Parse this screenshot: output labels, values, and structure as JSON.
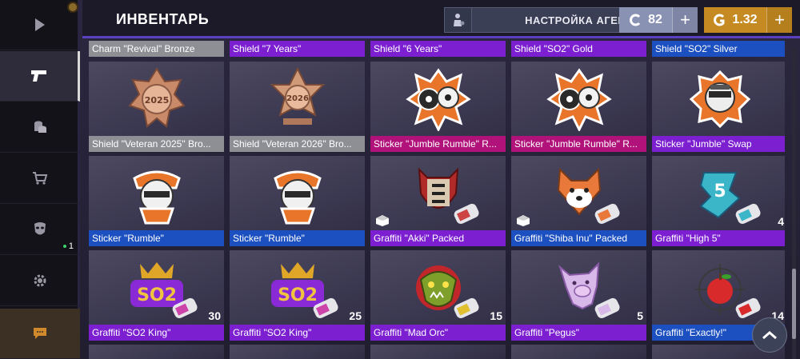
{
  "header": {
    "title": "ИНВЕНТАРЬ",
    "agent_button": "НАСТРОЙКА АГЕНТА",
    "silver_amount": "82",
    "gold_amount": "1.32",
    "plus": "+"
  },
  "sidebar": {
    "items": [
      {
        "name": "play",
        "icon": "play-icon"
      },
      {
        "name": "inventory",
        "icon": "pistol-icon"
      },
      {
        "name": "coins",
        "icon": "coins-icon"
      },
      {
        "name": "shop",
        "icon": "cart-icon"
      },
      {
        "name": "clan",
        "icon": "mask-icon",
        "badge": "1"
      },
      {
        "name": "settings",
        "icon": "gear-icon"
      },
      {
        "name": "chat",
        "icon": "chat-icon"
      }
    ]
  },
  "top_strip": [
    {
      "name": "Charm \"Revival\" Bronze",
      "rarity": "bronze"
    },
    {
      "name": "Shield \"7 Years\"",
      "rarity": "purple"
    },
    {
      "name": "Shield \"6 Years\"",
      "rarity": "purple"
    },
    {
      "name": "Shield \"SO2\" Gold",
      "rarity": "purple"
    },
    {
      "name": "Shield \"SO2\" Silver",
      "rarity": "blue"
    }
  ],
  "rows": [
    [
      {
        "name": "Shield \"Veteran 2025\" Bro...",
        "rarity": "bronze",
        "art": "2025"
      },
      {
        "name": "Shield \"Veteran 2026\" Bro...",
        "rarity": "bronze",
        "art": "2026"
      },
      {
        "name": "Sticker \"Jumble Rumble\" R...",
        "rarity": "magenta",
        "art": "jumble"
      },
      {
        "name": "Sticker \"Jumble Rumble\" R...",
        "rarity": "magenta",
        "art": "jumble"
      },
      {
        "name": "Sticker \"Jumble\" Swap",
        "rarity": "purple",
        "art": "jumble-swap"
      }
    ],
    [
      {
        "name": "Sticker \"Rumble\"",
        "rarity": "blue",
        "art": "rumble"
      },
      {
        "name": "Sticker \"Rumble\"",
        "rarity": "blue",
        "art": "rumble"
      },
      {
        "name": "Graffiti \"Akki\" Packed",
        "rarity": "purple",
        "art": "akki",
        "packed": true
      },
      {
        "name": "Graffiti \"Shiba Inu\" Packed",
        "rarity": "blue",
        "art": "shiba",
        "packed": true
      },
      {
        "name": "Graffiti \"High 5\"",
        "rarity": "purple",
        "art": "high5",
        "count": "4"
      }
    ],
    [
      {
        "name": "Graffiti \"SO2 King\"",
        "rarity": "purple",
        "art": "so2",
        "count": "30"
      },
      {
        "name": "Graffiti \"SO2 King\"",
        "rarity": "purple",
        "art": "so2",
        "count": "25"
      },
      {
        "name": "Graffiti \"Mad Orc\"",
        "rarity": "purple",
        "art": "orc",
        "count": "15"
      },
      {
        "name": "Graffiti \"Pegus\"",
        "rarity": "purple",
        "art": "pegus",
        "count": "5"
      },
      {
        "name": "Graffiti \"Exactly!\"",
        "rarity": "blue",
        "art": "apple",
        "count": "14"
      }
    ]
  ],
  "colors": {
    "bronze": "#8d8f95",
    "purple": "#7c1fd1",
    "magenta": "#b0127a",
    "blue": "#1c4fc0",
    "gold_currency": "#c58a21",
    "silver_currency": "#8a92b4"
  }
}
